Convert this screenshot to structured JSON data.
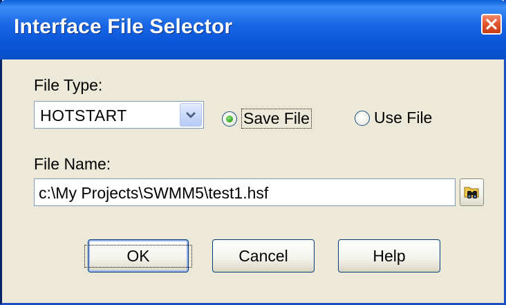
{
  "window": {
    "title": "Interface File Selector"
  },
  "file_type": {
    "label": "File Type:",
    "selected": "HOTSTART"
  },
  "mode": {
    "save_label": "Save File",
    "use_label": "Use File",
    "selected": "Save File"
  },
  "file_name": {
    "label": "File Name:",
    "value": "c:\\My Projects\\SWMM5\\test1.hsf"
  },
  "buttons": {
    "ok": "OK",
    "cancel": "Cancel",
    "help": "Help"
  },
  "icons": {
    "close": "close-icon",
    "dropdown": "chevron-down-icon",
    "browse": "binoculars-folder-icon"
  },
  "colors": {
    "titlebar": "#0b56d9",
    "dialog_bg": "#ece9d8",
    "close_button": "#e2542c",
    "radio_checked": "#2fa81e"
  }
}
